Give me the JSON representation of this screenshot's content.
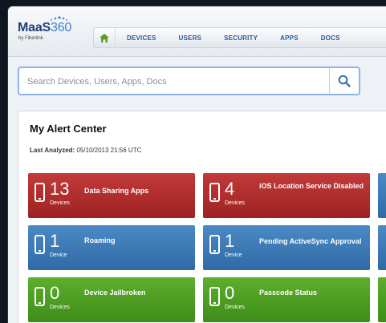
{
  "header": {
    "logo_main": "MaaS",
    "logo_num": "360",
    "logo_sub": "by Fiberlink",
    "nav": [
      {
        "label": "DEVICES"
      },
      {
        "label": "USERS"
      },
      {
        "label": "SECURITY"
      },
      {
        "label": "APPS"
      },
      {
        "label": "DOCS"
      }
    ]
  },
  "search": {
    "placeholder": "Search Devices, Users, Apps, Docs",
    "value": ""
  },
  "alert_center": {
    "title": "My Alert Center",
    "analyzed_label": "Last Analyzed:",
    "analyzed_value": "05/10/2013 21:56 UTC",
    "tiles": [
      {
        "count": "13",
        "unit": "Devices",
        "label": "Data Sharing Apps",
        "color": "#b02e2e"
      },
      {
        "count": "4",
        "unit": "Devices",
        "label": "iOS Location Service Disabled",
        "color": "#b02e2e"
      },
      {
        "count": "1",
        "unit": "Device",
        "label": "Roaming",
        "color": "#3d7ab8"
      },
      {
        "count": "1",
        "unit": "Device",
        "label": "Pending ActiveSync Approval",
        "color": "#3d7ab8"
      },
      {
        "count": "0",
        "unit": "Devices",
        "label": "Device Jailbroken",
        "color": "#4e9e23"
      },
      {
        "count": "0",
        "unit": "Devices",
        "label": "Passcode Status",
        "color": "#4e9e23"
      }
    ]
  },
  "icons": {
    "home": "home-icon",
    "search": "search-icon",
    "device": "phone-icon"
  }
}
